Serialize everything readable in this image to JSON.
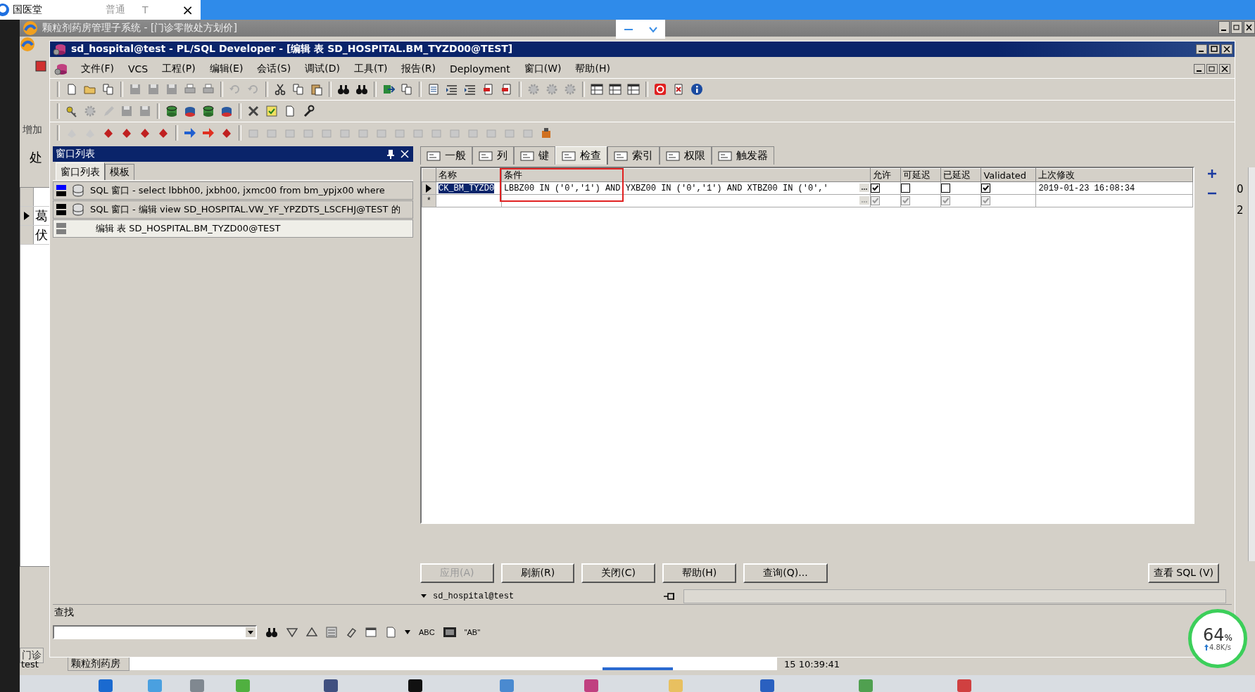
{
  "browser_tab": {
    "title": "国医堂",
    "mode": "普通",
    "mode_mark": "T",
    "close": "×"
  },
  "back_window": {
    "title": "颗粒剂药房管理子系统 - [门诊零散处方划价]",
    "add_label": "增加",
    "cut_label": "处",
    "rows": [
      "葛",
      "伏"
    ],
    "bottom_tab": "门诊",
    "right_cells": [
      "0",
      "2"
    ],
    "status_bar": [
      "test",
      "颗粒剂药房",
      "15 10:39:41"
    ]
  },
  "window": {
    "title": "sd_hospital@test - PL/SQL Developer - [编辑 表 SD_HOSPITAL.BM_TYZD00@TEST]"
  },
  "menu": [
    "文件(F)",
    "VCS",
    "工程(P)",
    "编辑(E)",
    "会话(S)",
    "调试(D)",
    "工具(T)",
    "报告(R)",
    "Deployment",
    "窗口(W)",
    "帮助(H)"
  ],
  "window_list": {
    "title": "窗口列表",
    "tabs": [
      {
        "label": "窗口列表",
        "selected": true
      },
      {
        "label": "模板",
        "selected": false
      }
    ],
    "items": [
      {
        "kind": "sql",
        "selected": false,
        "color": "#0000ff",
        "text": "SQL 窗口 - select lbbh00, jxbh00, jxmc00 from bm_ypjx00 where"
      },
      {
        "kind": "sql",
        "selected": false,
        "color": "#000000",
        "text": "SQL 窗口 - 编辑 view SD_HOSPITAL.VW_YF_YPZDTS_LSCFHJ@TEST 的"
      },
      {
        "kind": "table",
        "selected": true,
        "color": "#808080",
        "text": "编辑 表 SD_HOSPITAL.BM_TYZD00@TEST"
      }
    ]
  },
  "editor_tabs": [
    {
      "label": "一般",
      "selected": false
    },
    {
      "label": "列",
      "selected": false
    },
    {
      "label": "键",
      "selected": false
    },
    {
      "label": "检查",
      "selected": true
    },
    {
      "label": "索引",
      "selected": false
    },
    {
      "label": "权限",
      "selected": false
    },
    {
      "label": "触发器",
      "selected": false
    }
  ],
  "grid": {
    "columns": [
      "名称",
      "条件",
      "允许",
      "可延迟",
      "已延迟",
      "Validated",
      "上次修改"
    ],
    "rows": [
      {
        "kind": "record",
        "current": true,
        "name": "CK_BM_TYZD0",
        "condition": "LBBZ00 IN ('0','1') AND YXBZ00 IN ('0','1') AND XTBZ00 IN ('0','",
        "enabled": true,
        "deferrable": false,
        "deferred": false,
        "validated": true,
        "disabled": false,
        "modified": "2019-01-23 16:08:34"
      },
      {
        "kind": "new",
        "current": false,
        "marker": "*",
        "enabled": true,
        "deferrable": true,
        "deferred": true,
        "validated": true,
        "disabled": true
      }
    ]
  },
  "buttons": [
    {
      "label": "应用(A)",
      "disabled": true
    },
    {
      "label": "刷新(R)",
      "disabled": false
    },
    {
      "label": "关闭(C)",
      "disabled": false
    },
    {
      "label": "帮助(H)",
      "disabled": false
    },
    {
      "label": "查询(Q)...",
      "disabled": false
    }
  ],
  "view_sql": "查看 SQL (V)",
  "connection": {
    "name": "sd_hospital@test"
  },
  "find": {
    "title": "查找",
    "options": [
      "ABC",
      "\"AB\""
    ]
  },
  "net_widget": {
    "percent": "64",
    "unit": "%",
    "speed": "4.8K/s"
  }
}
